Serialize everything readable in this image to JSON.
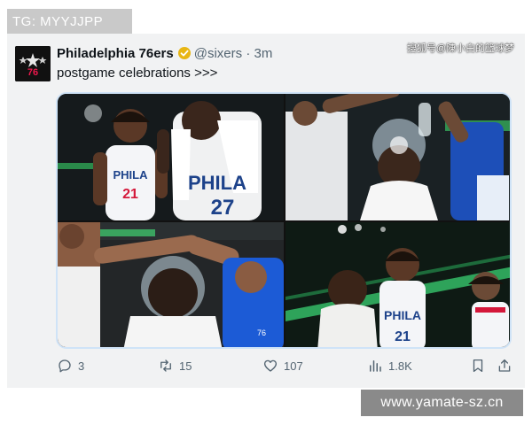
{
  "overlay": {
    "tg_label": "TG: MYYJJPP",
    "site_label": "www.yamate-sz.cn"
  },
  "tweet": {
    "author_name": "Philadelphia 76ers",
    "handle": "@sixers",
    "separator": "·",
    "time": "3m",
    "text": "postgame celebrations >>>",
    "watermark": "搜狐号@陳小白的篮球梦",
    "verified_color": "#e8b613",
    "avatar_icon": "sixers-logo-icon",
    "photo_jersey_numbers": [
      "21",
      "27",
      "21"
    ],
    "jersey_text": "PHILA",
    "actions": {
      "replies": "3",
      "reposts": "15",
      "likes": "107",
      "views": "1.8K"
    }
  }
}
